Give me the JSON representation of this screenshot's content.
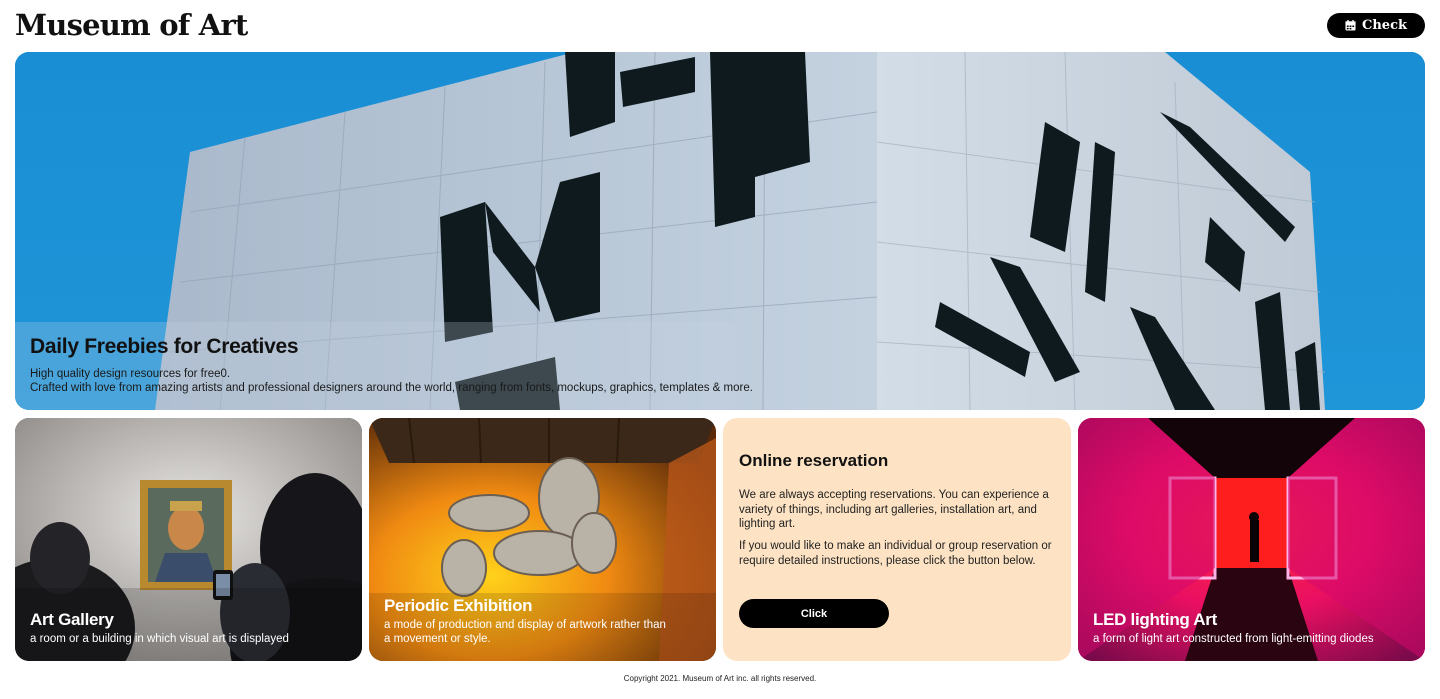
{
  "header": {
    "logo": "Museum of Art",
    "check_label": "Check",
    "check_icon": "calendar-icon"
  },
  "hero": {
    "title": "Daily Freebies for Creatives",
    "subtitle_line1": "High quality design resources for free0.",
    "subtitle_line2": "Crafted with love from amazing artists and professional designers around the world, ranging from fonts, mockups, graphics, templates & more."
  },
  "cards": [
    {
      "title": "Art Gallery",
      "description": "a room or a building in which visual art is displayed"
    },
    {
      "title": "Periodic Exhibition",
      "description": "a mode of production and display of artwork rather than a movement or style."
    },
    {
      "title": "Online reservation",
      "paragraph1": "We are always accepting reservations. You can experience a variety of things, including art galleries, installation art, and lighting art.",
      "paragraph2": "If you would like to make an individual or group reservation or require detailed instructions, please click the button below.",
      "button_label": "Click"
    },
    {
      "title": "LED lighting Art",
      "description": "a form of light art constructed from light-emitting diodes"
    }
  ],
  "footer": {
    "copyright": "Copyright 2021. Museum of Art inc. all rights reserved."
  },
  "colors": {
    "sky": "#1b8fd3",
    "building": "#b8c7d6",
    "reservation_bg": "#fde3c4",
    "led_magenta": "#e40e6a",
    "button_black": "#000000"
  }
}
